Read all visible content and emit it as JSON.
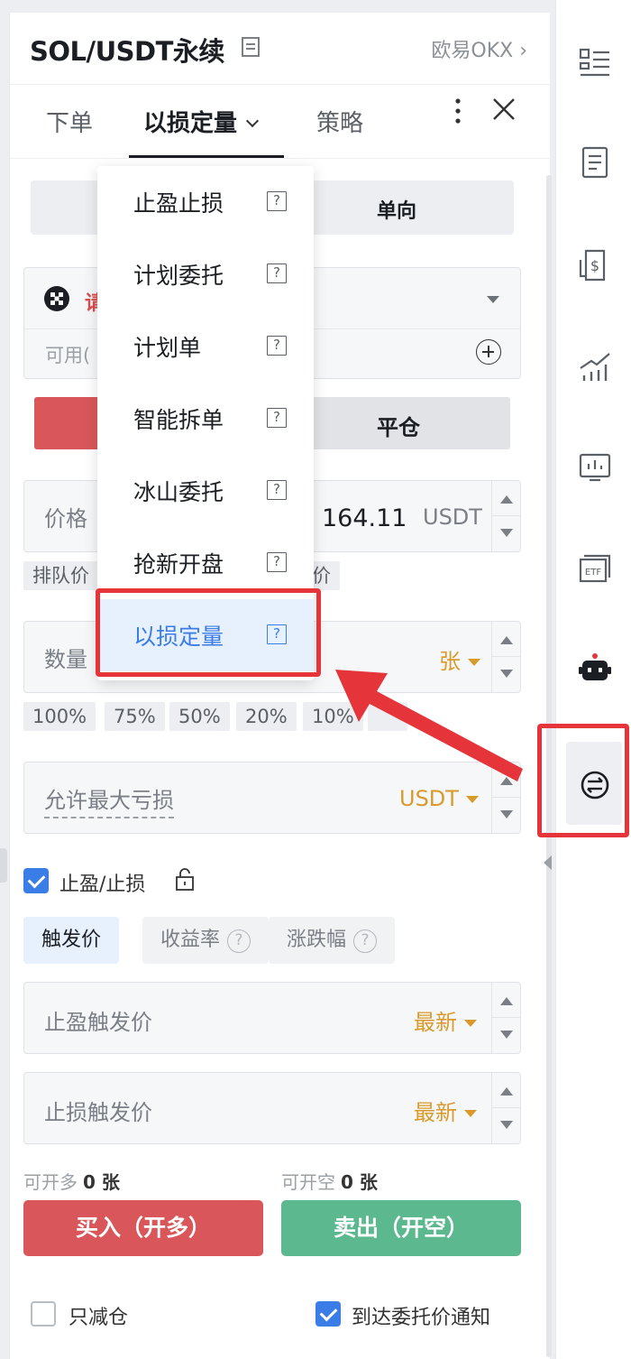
{
  "header": {
    "title": "SOL/USDT永续",
    "exchange": "欧易OKX ›"
  },
  "tabs": {
    "order": "下单",
    "loss_quantity": "以损定量",
    "strategy": "策略"
  },
  "position_mode": {
    "right_label": "单向"
  },
  "account": {
    "name_partial": "请",
    "available_partial": "可用("
  },
  "open_close": {
    "close_label": "平仓"
  },
  "price_field": {
    "label": "价格",
    "value": "164.11",
    "unit": "USDT"
  },
  "queue_chip": {
    "left": "排队价",
    "right": "价"
  },
  "quantity_field": {
    "label": "数量",
    "unit": "张"
  },
  "percent_chips": [
    "100%",
    "75%",
    "50%",
    "20%",
    "10%"
  ],
  "max_loss_field": {
    "label": "允许最大亏损",
    "unit": "USDT"
  },
  "tp_sl": {
    "label": "止盈/止损",
    "checked": true
  },
  "trigger_tabs": [
    "触发价",
    "收益率",
    "涨跌幅"
  ],
  "tp_field": {
    "label": "止盈触发价",
    "unit": "最新"
  },
  "sl_field": {
    "label": "止损触发价",
    "unit": "最新"
  },
  "stats": {
    "open_long_label": "可开多",
    "open_long_value": "0 张",
    "open_short_label": "可开空",
    "open_short_value": "0 张"
  },
  "buttons": {
    "buy": "买入（开多）",
    "sell": "卖出（开空）"
  },
  "footer": {
    "reduce_only": "只减仓",
    "notify": "到达委托价通知",
    "notify_checked": true,
    "reduce_only_checked": false
  },
  "dropdown": {
    "items": [
      {
        "label": "止盈止损",
        "help": "?"
      },
      {
        "label": "计划委托",
        "help": "?"
      },
      {
        "label": "计划单",
        "help": "?"
      },
      {
        "label": "智能拆单",
        "help": "?"
      },
      {
        "label": "冰山委托",
        "help": "?"
      },
      {
        "label": "抢新开盘",
        "help": "?"
      },
      {
        "label": "以损定量",
        "help": "?",
        "selected": true
      }
    ]
  },
  "colors": {
    "red": "#d9575a",
    "green": "#5cb88e",
    "blue": "#3b7de6",
    "orange": "#d99a2b",
    "annotation": "#e5353b"
  }
}
